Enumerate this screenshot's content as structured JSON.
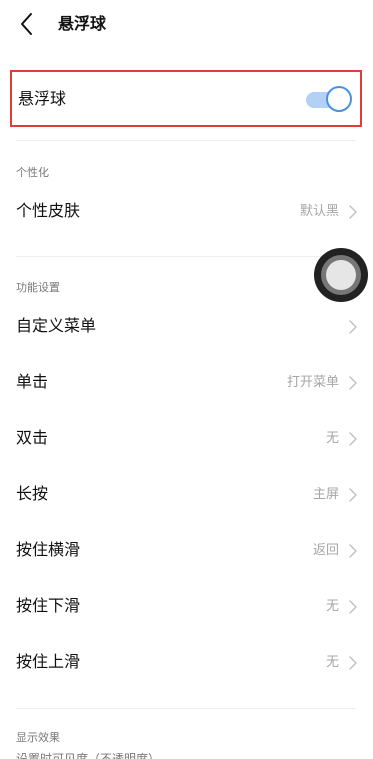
{
  "header": {
    "title": "悬浮球",
    "back_icon": "chevron-left-icon"
  },
  "main_toggle": {
    "label": "悬浮球",
    "enabled": true,
    "accent_color": "#4a90e2",
    "highlight_color": "#e23b3b"
  },
  "sections": {
    "personalize": {
      "title": "个性化"
    },
    "functions": {
      "title": "功能设置"
    },
    "display": {
      "title": "显示效果"
    }
  },
  "rows": {
    "skin": {
      "label": "个性皮肤",
      "value": "默认黑"
    },
    "custom_menu": {
      "label": "自定义菜单",
      "value": ""
    },
    "single_tap": {
      "label": "单击",
      "value": "打开菜单"
    },
    "double_tap": {
      "label": "双击",
      "value": "无"
    },
    "long_press": {
      "label": "长按",
      "value": "主屏"
    },
    "hold_swipe_horizontal": {
      "label": "按住横滑",
      "value": "返回"
    },
    "hold_swipe_down": {
      "label": "按住下滑",
      "value": "无"
    },
    "hold_swipe_up": {
      "label": "按住上滑",
      "value": "无"
    }
  },
  "cut_off_text": "设置时可见度（不透明度）",
  "floating_ball": {
    "icon": "assistive-touch-icon"
  }
}
